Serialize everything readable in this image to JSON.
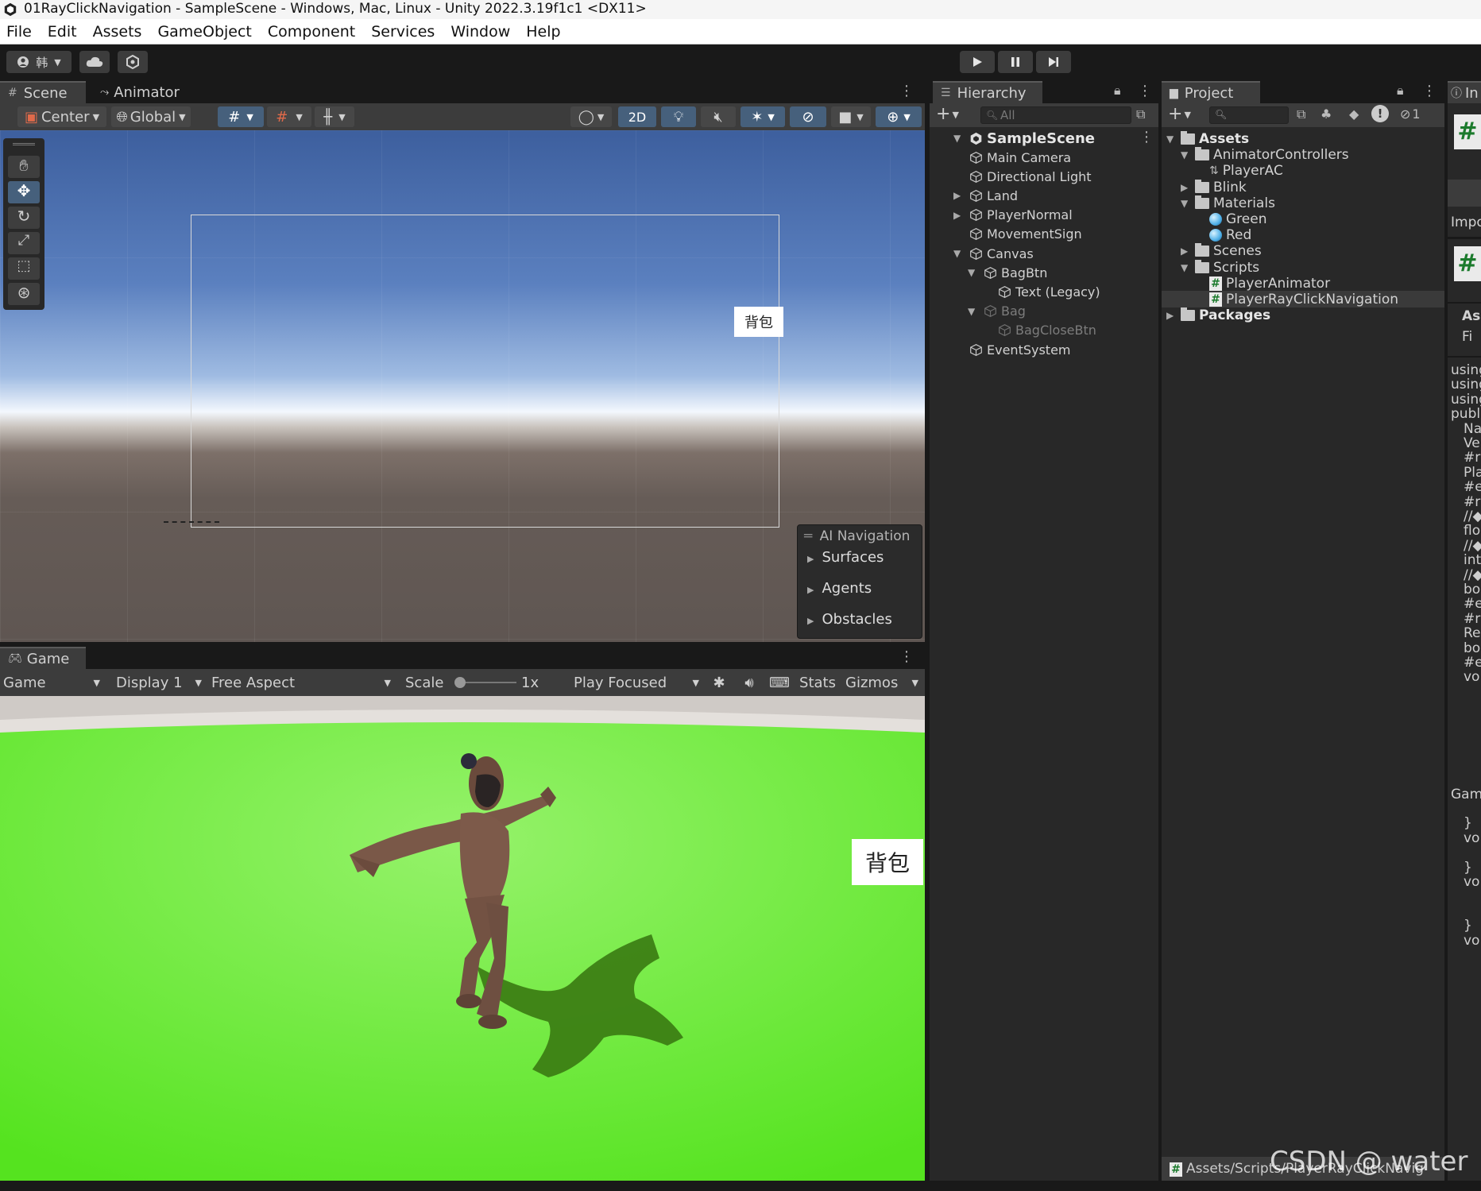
{
  "window": {
    "title": "01RayClickNavigation - SampleScene - Windows, Mac, Linux - Unity 2022.3.19f1c1 <DX11>"
  },
  "menu": [
    "File",
    "Edit",
    "Assets",
    "GameObject",
    "Component",
    "Services",
    "Window",
    "Help"
  ],
  "toolbar": {
    "account_label": "韩"
  },
  "scene": {
    "tabs": [
      "Scene",
      "Animator"
    ],
    "pivot_label": "Center",
    "space_label": "Global",
    "mode_2d_label": "2D",
    "ui_button_text": "背包",
    "overlay": {
      "title": "AI Navigation",
      "items": [
        "Surfaces",
        "Agents",
        "Obstacles"
      ]
    }
  },
  "game": {
    "tab": "Game",
    "view_label": "Game",
    "display_label": "Display 1",
    "aspect_label": "Free Aspect",
    "scale_label": "Scale",
    "scale_value": "1x",
    "play_mode_label": "Play Focused",
    "stats_label": "Stats",
    "gizmos_label": "Gizmos",
    "ui_button_text": "背包"
  },
  "hierarchy": {
    "tab": "Hierarchy",
    "search_placeholder": "All",
    "scene_name": "SampleScene",
    "items": [
      {
        "label": "Main Camera",
        "depth": 1,
        "expandable": false,
        "inactive": false
      },
      {
        "label": "Directional Light",
        "depth": 1,
        "expandable": false,
        "inactive": false
      },
      {
        "label": "Land",
        "depth": 1,
        "expandable": true,
        "expanded": false,
        "inactive": false
      },
      {
        "label": "PlayerNormal",
        "depth": 1,
        "expandable": true,
        "expanded": false,
        "inactive": false
      },
      {
        "label": "MovementSign",
        "depth": 1,
        "expandable": false,
        "inactive": false
      },
      {
        "label": "Canvas",
        "depth": 1,
        "expandable": true,
        "expanded": true,
        "inactive": false
      },
      {
        "label": "BagBtn",
        "depth": 2,
        "expandable": true,
        "expanded": true,
        "inactive": false
      },
      {
        "label": "Text (Legacy)",
        "depth": 3,
        "expandable": false,
        "inactive": false
      },
      {
        "label": "Bag",
        "depth": 2,
        "expandable": true,
        "expanded": true,
        "inactive": true
      },
      {
        "label": "BagCloseBtn",
        "depth": 3,
        "expandable": false,
        "inactive": true
      },
      {
        "label": "EventSystem",
        "depth": 1,
        "expandable": false,
        "inactive": false
      }
    ]
  },
  "project": {
    "tab": "Project",
    "hidden_count": "1",
    "items": [
      {
        "label": "Assets",
        "depth": 0,
        "kind": "folder-open",
        "expandable": true,
        "expanded": true,
        "bold": true
      },
      {
        "label": "AnimatorControllers",
        "depth": 1,
        "kind": "folder-open",
        "expandable": true,
        "expanded": true
      },
      {
        "label": "PlayerAC",
        "depth": 2,
        "kind": "animator"
      },
      {
        "label": "Blink",
        "depth": 1,
        "kind": "folder",
        "expandable": true,
        "expanded": false
      },
      {
        "label": "Materials",
        "depth": 1,
        "kind": "folder-open",
        "expandable": true,
        "expanded": true
      },
      {
        "label": "Green",
        "depth": 2,
        "kind": "material"
      },
      {
        "label": "Red",
        "depth": 2,
        "kind": "material"
      },
      {
        "label": "Scenes",
        "depth": 1,
        "kind": "folder",
        "expandable": true,
        "expanded": false
      },
      {
        "label": "Scripts",
        "depth": 1,
        "kind": "folder-open",
        "expandable": true,
        "expanded": true
      },
      {
        "label": "PlayerAnimator",
        "depth": 2,
        "kind": "script"
      },
      {
        "label": "PlayerRayClickNavigation",
        "depth": 2,
        "kind": "script",
        "selected": true
      },
      {
        "label": "Packages",
        "depth": 0,
        "kind": "folder",
        "expandable": true,
        "expanded": false,
        "bold": true
      }
    ],
    "status_path": "Assets/Scripts/PlayerRayClickNavig"
  },
  "inspector": {
    "tab": "In",
    "import_label": "Impo",
    "asset_label": "As",
    "file_label": "Fi",
    "code_lines": [
      "using",
      "using",
      "using",
      "publi",
      "Na",
      "Ve",
      "#r",
      "Pla",
      "#e",
      "#r",
      "//◆",
      "flo",
      "//◆",
      "int",
      "//◆",
      "bo",
      "#e",
      "#r",
      "Re",
      "bo",
      "#e",
      "vo",
      "",
      "",
      "",
      "",
      "",
      "",
      "",
      "Gam",
      "",
      "}",
      "vo",
      "",
      "}",
      "vo",
      "",
      "",
      "}",
      "vo"
    ]
  },
  "watermark": "CSDN @ water"
}
